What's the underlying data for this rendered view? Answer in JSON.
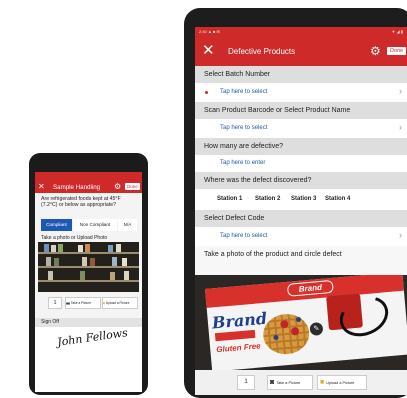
{
  "phone": {
    "title": "Sample Handling",
    "done": "Done",
    "question": "Are refrigerated foods kept at 45°F (7.2°C) or below as appropriate?",
    "options": [
      "Compliant",
      "Non Compliant",
      "N/A"
    ],
    "selected_option": "Compliant",
    "photo_label": "Take a photo or Upload Photo",
    "count": "1",
    "take_picture": "Take a Picture",
    "upload_picture": "Upload a Picture",
    "signoff_label": "Sign Off",
    "signature": "John Fellows"
  },
  "tablet": {
    "status_left": "2:40 ▲ ■ ✉",
    "status_right": "▼ ◢ ▮",
    "title": "Defective Products",
    "done": "Done",
    "sections": {
      "batch": "Select Batch Number",
      "scan": "Scan Product Barcode or Select Product Name",
      "how_many": "How many are defective?",
      "where": "Where was the defect discovered?",
      "defect_code": "Select Defect Code",
      "photo": "Take a photo of the product and circle defect"
    },
    "tap_select": "Tap here to select",
    "tap_enter": "Tap here to enter",
    "stations": [
      "Station 1",
      "Station 2",
      "Station 3",
      "Station 4"
    ],
    "photo": {
      "badge": "Brand",
      "brand": "Brand",
      "tagline": "Gluten Free"
    },
    "count": "1",
    "take_picture": "Take a Picture",
    "upload_picture": "Upload a Picture"
  },
  "colors": {
    "brand_red": "#cf2a2a",
    "selected_blue": "#1f57b5",
    "link_blue": "#2557a8"
  }
}
